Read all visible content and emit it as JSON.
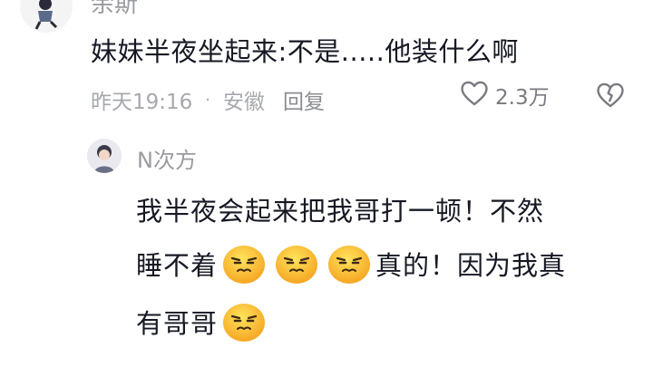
{
  "top_comment": {
    "author": "余斯",
    "text": "妹妹半夜坐起来:不是.....他装什么啊",
    "time": "昨天19:16",
    "location": "安徽",
    "reply_label": "回复",
    "like_count": "2.3万"
  },
  "reply": {
    "author": "N次方",
    "line1": "我半夜会起来把我哥打一顿！不然",
    "line2_before": "睡不着",
    "line2_after": "真的！因为我真",
    "line3": "有哥哥",
    "emoji_name": "annoyed-face-emoji"
  }
}
